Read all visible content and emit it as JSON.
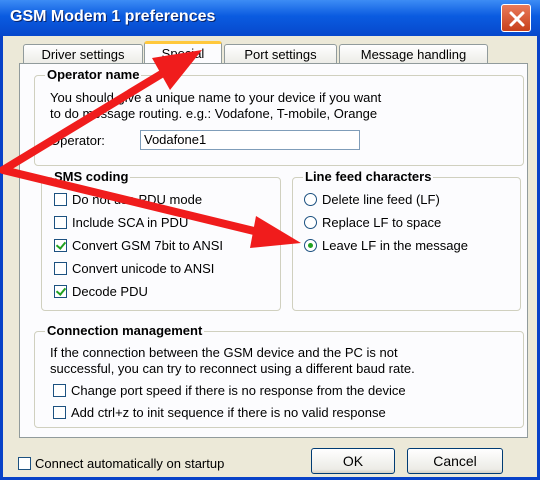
{
  "window": {
    "title": "GSM Modem 1 preferences"
  },
  "tabs": [
    {
      "label": "Driver settings",
      "active": false
    },
    {
      "label": "Special",
      "active": true
    },
    {
      "label": "Port settings",
      "active": false
    },
    {
      "label": "Message handling",
      "active": false
    }
  ],
  "operator_group": {
    "legend": "Operator name",
    "description_line1": "You should give a unique name to your device if you want",
    "description_line2": "to do message routing. e.g.: Vodafone, T-mobile, Orange",
    "operator_label": "Operator:",
    "operator_value": "Vodafone1"
  },
  "sms_coding": {
    "legend": "SMS coding",
    "options": [
      {
        "label": "Do not use PDU mode",
        "checked": false
      },
      {
        "label": "Include SCA in PDU",
        "checked": false
      },
      {
        "label": "Convert GSM 7bit to ANSI",
        "checked": true
      },
      {
        "label": "Convert unicode to ANSI",
        "checked": false
      },
      {
        "label": "Decode PDU",
        "checked": true
      }
    ]
  },
  "line_feed": {
    "legend": "Line feed characters",
    "options": [
      {
        "label": "Delete line feed (LF)",
        "selected": false
      },
      {
        "label": "Replace LF to space",
        "selected": false
      },
      {
        "label": "Leave LF in the message",
        "selected": true
      }
    ]
  },
  "connection": {
    "legend": "Connection management",
    "description_line1": "If the connection between the GSM device and the PC is not",
    "description_line2": "successful, you can try to reconnect using a different baud rate.",
    "options": [
      {
        "label": "Change port speed if there is no response from the device",
        "checked": false
      },
      {
        "label": "Add ctrl+z to init sequence if there is no valid response",
        "checked": false
      }
    ]
  },
  "footer": {
    "auto_connect_label": "Connect automatically on startup",
    "auto_connect_checked": false,
    "ok_label": "OK",
    "cancel_label": "Cancel"
  },
  "colors": {
    "arrow": "#F01C1C",
    "titlebar": "#0A5BE0"
  }
}
